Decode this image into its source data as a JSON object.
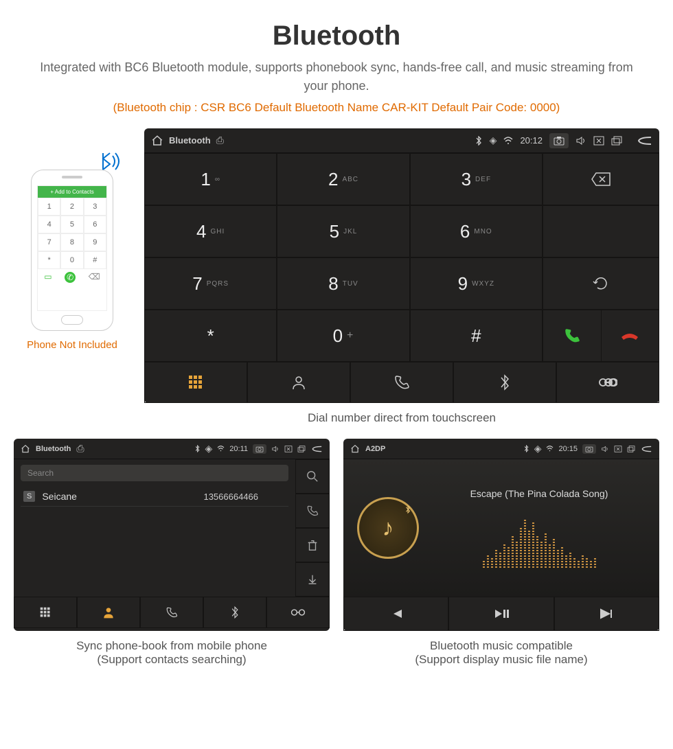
{
  "header": {
    "title": "Bluetooth",
    "description": "Integrated with BC6 Bluetooth module, supports phonebook sync, hands-free call, and music streaming from your phone.",
    "specs": "(Bluetooth chip : CSR BC6     Default Bluetooth Name CAR-KIT    Default Pair Code: 0000)"
  },
  "phone_mock": {
    "top_label": "Add to Contacts",
    "keys": [
      "1",
      "2",
      "3",
      "4",
      "5",
      "6",
      "7",
      "8",
      "9",
      "*",
      "0",
      "#"
    ],
    "caption": "Phone Not Included"
  },
  "dialer": {
    "status": {
      "app": "Bluetooth",
      "time": "20:12"
    },
    "keys": [
      {
        "num": "1",
        "sub": "∞"
      },
      {
        "num": "2",
        "sub": "ABC"
      },
      {
        "num": "3",
        "sub": "DEF"
      },
      {
        "num": "4",
        "sub": "GHI"
      },
      {
        "num": "5",
        "sub": "JKL"
      },
      {
        "num": "6",
        "sub": "MNO"
      },
      {
        "num": "7",
        "sub": "PQRS"
      },
      {
        "num": "8",
        "sub": "TUV"
      },
      {
        "num": "9",
        "sub": "WXYZ"
      },
      {
        "num": "*",
        "sub": ""
      },
      {
        "num": "0",
        "sub": "+"
      },
      {
        "num": "#",
        "sub": ""
      }
    ],
    "caption": "Dial number direct from touchscreen"
  },
  "contacts": {
    "status": {
      "app": "Bluetooth",
      "time": "20:11"
    },
    "search_placeholder": "Search",
    "rows": [
      {
        "badge": "S",
        "name": "Seicane",
        "number": "13566664466"
      }
    ],
    "caption_line1": "Sync phone-book from mobile phone",
    "caption_line2": "(Support contacts searching)"
  },
  "music": {
    "status": {
      "app": "A2DP",
      "time": "20:15"
    },
    "song": "Escape (The Pina Colada Song)",
    "caption_line1": "Bluetooth music compatible",
    "caption_line2": "(Support display music file name)"
  }
}
